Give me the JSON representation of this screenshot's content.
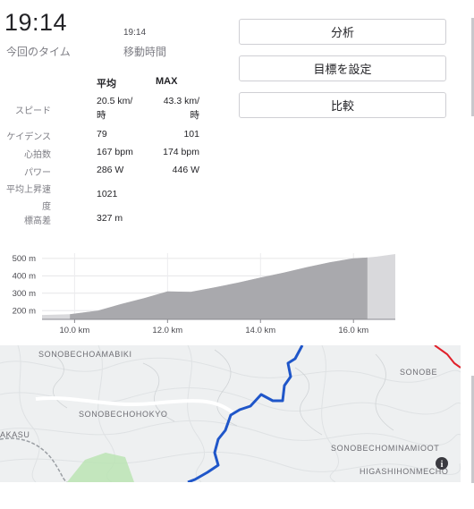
{
  "summary": {
    "elapsed_time": "19:14",
    "elapsed_time_label": "今回のタイム",
    "moving_time": "19:14",
    "moving_time_label": "移動時間"
  },
  "buttons": {
    "analysis": "分析",
    "set_goal": "目標を設定",
    "compare": "比較"
  },
  "stats": {
    "col_avg": "平均",
    "col_max": "MAX",
    "rows": [
      {
        "label": "スピード",
        "avg": "20.5 km/時",
        "max": "43.3 km/時"
      },
      {
        "label": "ケイデンス",
        "avg": "79",
        "max": "101"
      },
      {
        "label": "心拍数",
        "avg": "167 bpm",
        "max": "174 bpm"
      },
      {
        "label": "パワー",
        "avg": "286 W",
        "max": "446 W"
      },
      {
        "label": "平均上昇速度",
        "avg": "1021",
        "max": ""
      },
      {
        "label": "標高差",
        "avg": "327 m",
        "max": ""
      }
    ],
    "speed_avg_line1": "20.5 km/",
    "speed_avg_line2": "時",
    "speed_max_line1": "43.3 km/",
    "speed_max_line2": "時",
    "vam_label_line1": "平均上昇速",
    "vam_label_line2": "度"
  },
  "chart_data": {
    "type": "area",
    "title": "",
    "xlabel": "",
    "ylabel": "",
    "x_ticks": [
      "10.0 km",
      "12.0 km",
      "14.0 km",
      "16.0 km"
    ],
    "y_ticks": [
      "200 m",
      "300 m",
      "400 m",
      "500 m"
    ],
    "xlim": [
      9.3,
      16.9
    ],
    "ylim": [
      150,
      530
    ],
    "highlight_range_km": [
      9.9,
      16.3
    ],
    "x": [
      9.3,
      9.9,
      10.5,
      11.0,
      11.5,
      12.0,
      12.5,
      13.0,
      13.5,
      14.0,
      14.5,
      15.0,
      15.5,
      16.0,
      16.3,
      16.5,
      16.9
    ],
    "y": [
      175,
      180,
      200,
      238,
      272,
      310,
      308,
      333,
      360,
      390,
      418,
      450,
      478,
      500,
      505,
      510,
      525
    ]
  },
  "map": {
    "labels": [
      "SONOBECHOAMABIKI",
      "SONOBECHOHOKYO",
      "AKASU",
      "SONOBE",
      "SONOBECHOMINAMIOOT",
      "HIGASHIHONMECHO"
    ],
    "info_icon": "info-icon",
    "route_color": "#1f56c9",
    "other_route_color": "#e0202a"
  },
  "colors": {
    "area_selected": "#a9a9ad",
    "area_unselected": "#d9d9dc",
    "button_border": "#cfcfd4"
  }
}
